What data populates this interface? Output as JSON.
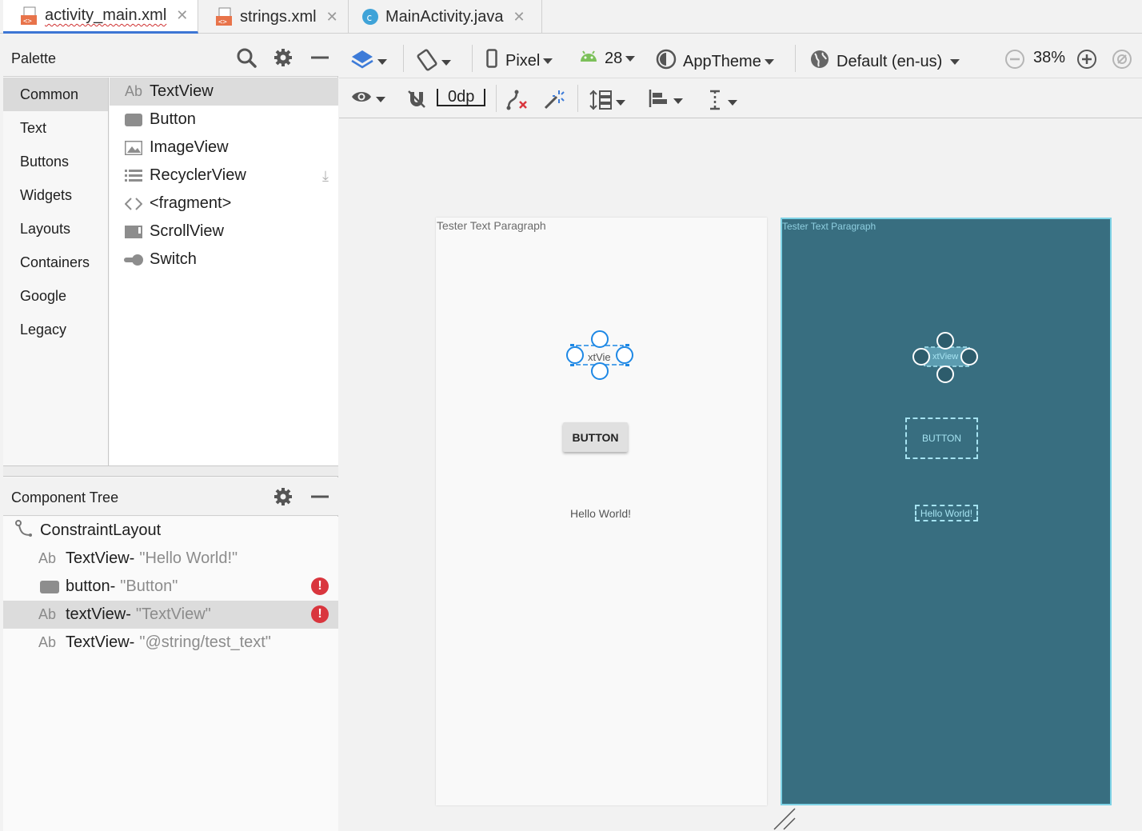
{
  "tabs": [
    {
      "label": "activity_main.xml",
      "icon": "xml-file-icon",
      "active": true
    },
    {
      "label": "strings.xml",
      "icon": "xml-file-icon",
      "active": false
    },
    {
      "label": "MainActivity.java",
      "icon": "java-class-icon",
      "active": false
    }
  ],
  "palette": {
    "title": "Palette",
    "categories": [
      "Common",
      "Text",
      "Buttons",
      "Widgets",
      "Layouts",
      "Containers",
      "Google",
      "Legacy"
    ],
    "widgets": [
      {
        "label": "TextView",
        "icon": "textview-icon"
      },
      {
        "label": "Button",
        "icon": "button-icon"
      },
      {
        "label": "ImageView",
        "icon": "imageview-icon"
      },
      {
        "label": "RecyclerView",
        "icon": "recyclerview-icon"
      },
      {
        "label": "<fragment>",
        "icon": "fragment-icon"
      },
      {
        "label": "ScrollView",
        "icon": "scrollview-icon"
      },
      {
        "label": "Switch",
        "icon": "switch-icon"
      }
    ],
    "textview_icon_text": "Ab"
  },
  "component_tree": {
    "title": "Component Tree",
    "root": "ConstraintLayout",
    "items": [
      {
        "name": "TextView",
        "value": "\"Hello World!\"",
        "icon": "Ab",
        "error": false
      },
      {
        "name": "button",
        "value": "\"Button\"",
        "icon": "button-icon",
        "error": true
      },
      {
        "name": "textView",
        "value": "\"TextView\"",
        "icon": "Ab",
        "error": true
      },
      {
        "name": "TextView",
        "value": "\"@string/test_text\"",
        "icon": "Ab",
        "error": false
      }
    ],
    "dash": "-",
    "error_glyph": "!"
  },
  "toolbar": {
    "device": "Pixel",
    "api": "28",
    "theme": "AppTheme",
    "locale": "Default (en-us)",
    "zoom": "38%",
    "margin": "0dp"
  },
  "design_preview": {
    "paragraph": "Tester Text Paragraph",
    "textview_partial": "xtVie",
    "button": "BUTTON",
    "hello": "Hello World!"
  },
  "blueprint_preview": {
    "paragraph": "Tester Text Paragraph",
    "textview_partial": "xtView",
    "button": "BUTTON",
    "hello": "Hello World!"
  },
  "colors": {
    "accent": "#3d76d4",
    "blueprint_bg": "#386e80",
    "blueprint_line": "#a6e3f1",
    "error": "#d9363e",
    "handle": "#1e88e5"
  }
}
